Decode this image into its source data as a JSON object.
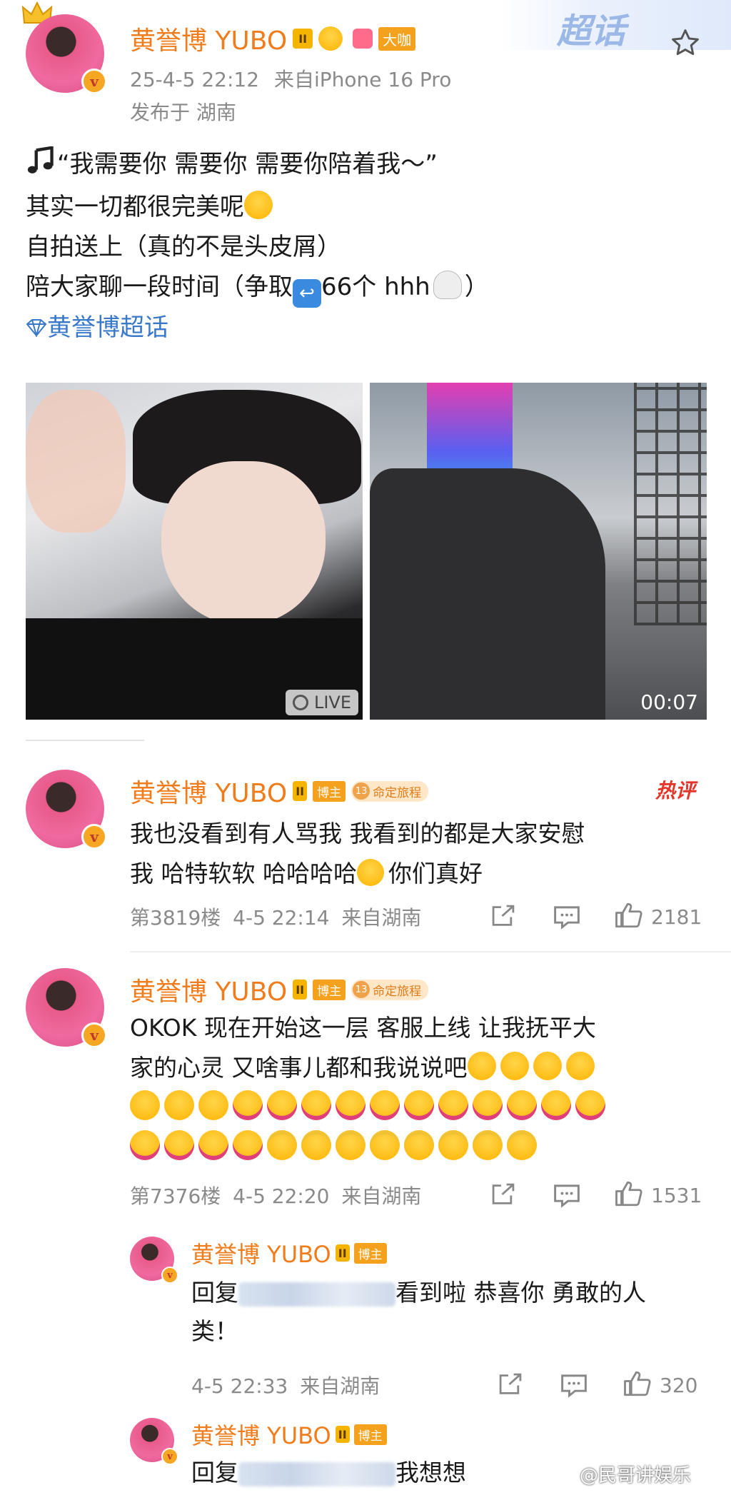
{
  "post": {
    "username": "黄誉博 YUBO",
    "level": "II",
    "vip_badge": "大咖",
    "timestamp": "25-4-5 22:12",
    "source": "来自iPhone 16 Pro",
    "location": "发布于 湖南",
    "supertopic_badge": "超话",
    "lines": [
      "“我需要你 需要你 需要你陪着我～”",
      "其实一切都很完美呢",
      "自拍送上（真的不是头皮屑）",
      "陪大家聊一段时间（争取",
      "66个 hhh",
      "）"
    ],
    "topic_link": "黄誉博超话",
    "live_label": "LIVE",
    "video_duration": "00:07"
  },
  "comments": [
    {
      "username": "黄誉博 YUBO",
      "role": "博主",
      "journey_level": "13",
      "journey_label": "命定旅程",
      "hot_label": "热评",
      "text_line1": "我也没看到有人骂我 我看到的都是大家安慰",
      "text_line2": "我 哈特软软 哈哈哈哈",
      "text_line2_tail": "你们真好",
      "floor": "第3819楼",
      "time": "4-5 22:14",
      "from": "来自湖南",
      "likes": "2181"
    },
    {
      "username": "黄誉博 YUBO",
      "role": "博主",
      "journey_level": "13",
      "journey_label": "命定旅程",
      "text_line1": "OKOK 现在开始这一层 客服上线 让我抚平大",
      "text_line2": "家的心灵 又啥事儿都和我说说吧",
      "floor": "第7376楼",
      "time": "4-5 22:20",
      "from": "来自湖南",
      "likes": "1531"
    }
  ],
  "replies": [
    {
      "username": "黄誉博 YUBO",
      "role": "博主",
      "reply_prefix": "回复",
      "text_tail": "看到啦 恭喜你 勇敢的人",
      "text_line2": "类！",
      "time": "4-5 22:33",
      "from": "来自湖南",
      "likes": "320"
    },
    {
      "username": "黄誉博 YUBO",
      "role": "博主",
      "reply_prefix": "回复",
      "text_tail": "我想想"
    }
  ],
  "watermark": "@民哥讲娱乐",
  "icons": {
    "star": "star-outline-icon",
    "share": "share-icon",
    "comment": "comment-icon",
    "like": "thumbs-up-icon",
    "music": "music-note-icon",
    "diamond": "diamond-icon"
  },
  "colors": {
    "accent": "#f07c1c",
    "link": "#3a78c9",
    "hot": "#e5352b"
  }
}
